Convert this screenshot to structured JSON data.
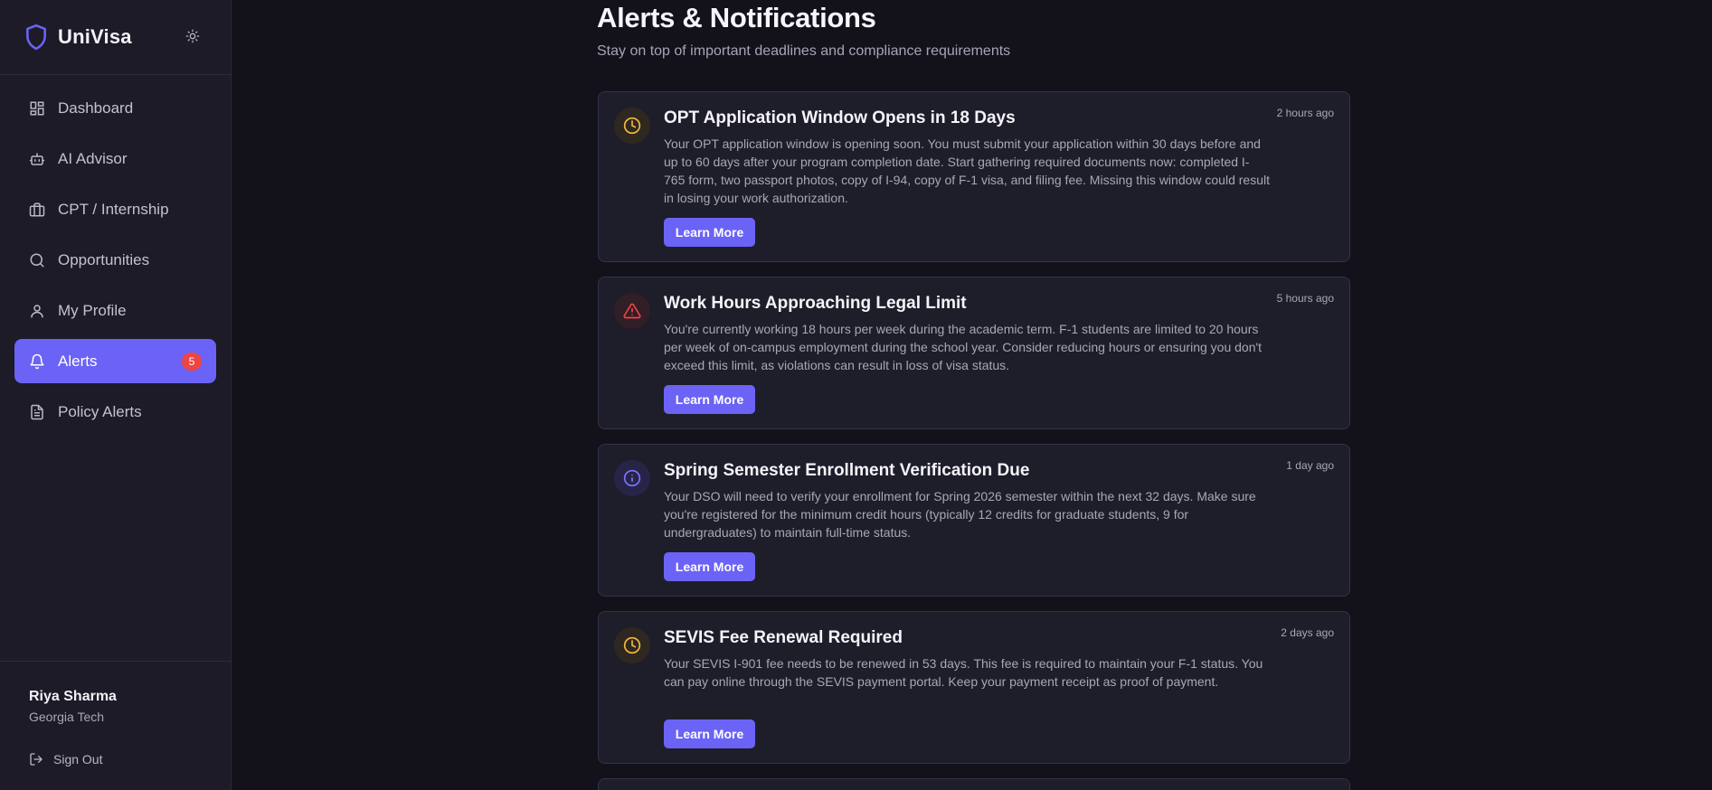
{
  "app": {
    "name": "UniVisa"
  },
  "sidebar": {
    "items": [
      {
        "label": "Dashboard",
        "icon": "dashboard-icon"
      },
      {
        "label": "AI Advisor",
        "icon": "bot-icon"
      },
      {
        "label": "CPT / Internship",
        "icon": "briefcase-icon"
      },
      {
        "label": "Opportunities",
        "icon": "search-icon"
      },
      {
        "label": "My Profile",
        "icon": "user-icon"
      },
      {
        "label": "Alerts",
        "icon": "bell-icon",
        "active": true,
        "badge": "5"
      },
      {
        "label": "Policy Alerts",
        "icon": "document-icon"
      }
    ],
    "user": {
      "name": "Riya Sharma",
      "school": "Georgia Tech"
    },
    "signout_label": "Sign Out"
  },
  "main": {
    "title": "Alerts & Notifications",
    "subtitle": "Stay on top of important deadlines and compliance requirements",
    "alerts": [
      {
        "icon": "clock-icon",
        "title": "OPT Application Window Opens in 18 Days",
        "time": "2 hours ago",
        "body": "Your OPT application window is opening soon. You must submit your application within 30 days before and up to 60 days after your program completion date. Start gathering required documents now: completed I-765 form, two passport photos, copy of I-94, copy of F-1 visa, and filing fee. Missing this window could result in losing your work authorization.",
        "button": "Learn More"
      },
      {
        "icon": "warning-icon",
        "title": "Work Hours Approaching Legal Limit",
        "time": "5 hours ago",
        "body": "You're currently working 18 hours per week during the academic term. F-1 students are limited to 20 hours per week of on-campus employment during the school year. Consider reducing hours or ensuring you don't exceed this limit, as violations can result in loss of visa status.",
        "button": "Learn More"
      },
      {
        "icon": "info-icon",
        "title": "Spring Semester Enrollment Verification Due",
        "time": "1 day ago",
        "body": "Your DSO will need to verify your enrollment for Spring 2026 semester within the next 32 days. Make sure you're registered for the minimum credit hours (typically 12 credits for graduate students, 9 for undergraduates) to maintain full-time status.",
        "button": "Learn More"
      },
      {
        "icon": "clock-icon",
        "title": "SEVIS Fee Renewal Required",
        "time": "2 days ago",
        "body": "Your SEVIS I-901 fee needs to be renewed in 53 days. This fee is required to maintain your F-1 status. You can pay online through the SEVIS payment portal. Keep your payment receipt as proof of payment.",
        "button": "Learn More"
      }
    ]
  },
  "colors": {
    "accent": "#6b63f5",
    "badge": "#ef4444",
    "clock": "#f5b942",
    "warning": "#ef4444",
    "info": "#6b63f5"
  }
}
